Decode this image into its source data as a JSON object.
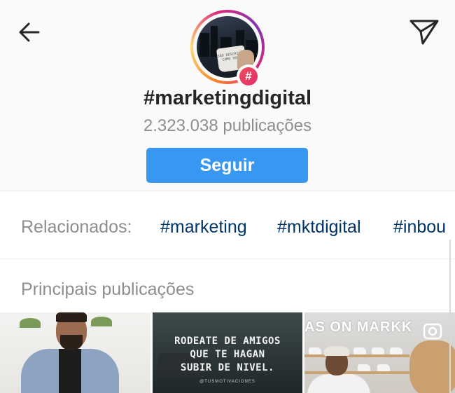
{
  "header": {
    "back_icon": "arrow-left-icon",
    "send_icon": "paper-plane-icon",
    "hashtag_symbol": "#",
    "title": "#marketingdigital",
    "post_count": "2.323.038 publicações",
    "follow_label": "Seguir",
    "follow_color": "#3897f0"
  },
  "avatar": {
    "mug_text": "SÃO DESCRITOS COMO VOCÊ"
  },
  "related": {
    "label": "Relacionados:",
    "tags": [
      "#marketing",
      "#mktdigital",
      "#inbou"
    ]
  },
  "top_posts": {
    "title": "Principais publicações",
    "posts": [
      {
        "kind": "photo-man-in-blazer"
      },
      {
        "kind": "quote-image",
        "text_lines": [
          "RODEATE DE AMIGOS",
          "QUE TE HAGAN",
          "SUBIR DE NIVEL."
        ],
        "credit": "@TUSMOTIVACIONES"
      },
      {
        "kind": "video-store",
        "sign": "AS ON MARKK",
        "video_icon": "video-camera-icon"
      }
    ]
  },
  "colors": {
    "text_primary": "#262626",
    "text_secondary": "#8e8e8e",
    "link": "#003569"
  }
}
